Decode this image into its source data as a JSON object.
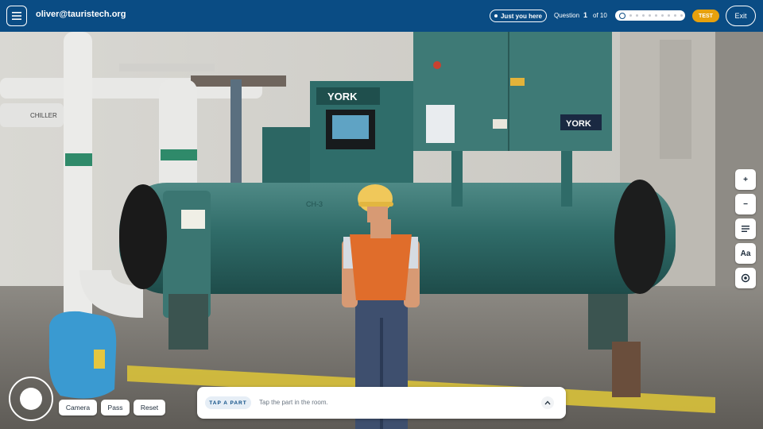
{
  "header": {
    "user_email": "oliver@tauristech.org",
    "presence_label": "Just you here",
    "question_label": "Question",
    "question_current": "1",
    "question_total": "of 10",
    "progress_steps": 10,
    "progress_completed": 0,
    "mode_badge": "TEST",
    "exit_label": "Exit",
    "colors": {
      "bar": "#0a4c84",
      "badge": "#e7a10d"
    }
  },
  "scene": {
    "brand_label_panel": "YORK",
    "brand_label_cabinet": "YORK",
    "tank_label": "CH-3",
    "pipe_label": "CHILLER"
  },
  "tools": {
    "zoom_in": "+",
    "zoom_out": "−",
    "text_size": "Aa",
    "icons": [
      "plus-icon",
      "minus-icon",
      "list-icon",
      "text-size-icon",
      "target-icon"
    ]
  },
  "controls": {
    "camera_label": "Camera",
    "pass_label": "Pass",
    "reset_label": "Reset"
  },
  "prompt": {
    "tag": "TAP A PART",
    "instruction": "Tap the part in the room."
  }
}
